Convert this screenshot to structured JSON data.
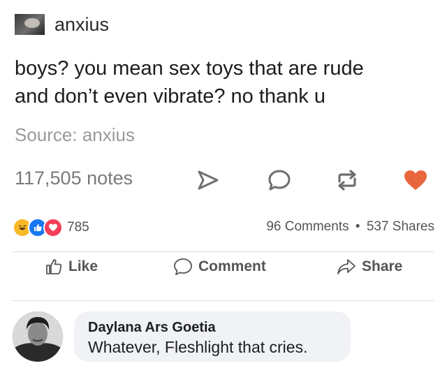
{
  "tumblr_post": {
    "username": "anxius",
    "body_lines": [
      "boys? you mean sex toys that are rude",
      "and don’t even vibrate? no thank u"
    ],
    "source": "Source: anxius",
    "notes": "117,505 notes",
    "icons": [
      "share-arrow-icon",
      "reply-bubble-icon",
      "reblog-icon",
      "heart-icon"
    ],
    "colors": {
      "heart": "#e8663d",
      "text": "#1c1c1c",
      "muted": "#9a9a9a"
    }
  },
  "facebook": {
    "reaction_count": "785",
    "comments": "96 Comments",
    "separator": "•",
    "shares": "537 Shares",
    "reactions": [
      "haha-icon",
      "like-icon",
      "love-icon"
    ],
    "actions": {
      "like": "Like",
      "comment": "Comment",
      "share": "Share"
    },
    "top_comment": {
      "author": "Daylana Ars Goetia",
      "text": "Whatever, Fleshlight that cries."
    },
    "colors": {
      "like_blue": "#1877f2",
      "love_red": "#f33e58",
      "haha_yellow": "#f7b928"
    }
  }
}
